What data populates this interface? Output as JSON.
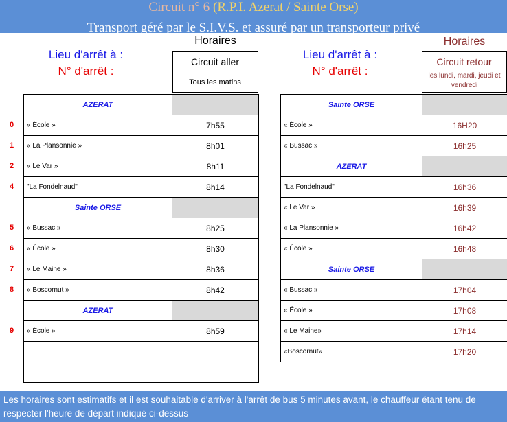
{
  "header": {
    "title_prefix": "Circuit n° 6",
    "title_route": "(R.P.I. Azerat / Sainte Orse)",
    "subtitle": "Transport géré par le S.I.V.S. et assuré par un transporteur privé"
  },
  "labels": {
    "lieu": "Lieu d'arrêt à :",
    "numero": "N° d'arrêt :"
  },
  "aller": {
    "horaires": "Horaires",
    "circuit": "Circuit aller",
    "frequency": "Tous les matins",
    "rows": [
      {
        "type": "section",
        "name": "AZERAT",
        "time": ""
      },
      {
        "type": "stop",
        "num": "0",
        "name": "« École »",
        "time": "7h55"
      },
      {
        "type": "stop",
        "num": "1",
        "name": "« La Plansonnie »",
        "time": "8h01"
      },
      {
        "type": "stop",
        "num": "2",
        "name": "« Le Var »",
        "time": "8h11"
      },
      {
        "type": "stop",
        "num": "4",
        "name": "\"La Fondelnaud\"",
        "time": "8h14"
      },
      {
        "type": "section",
        "name": "Sainte ORSE",
        "time": ""
      },
      {
        "type": "stop",
        "num": "5",
        "name": " « Bussac »",
        "time": "8h25"
      },
      {
        "type": "stop",
        "num": "6",
        "name": "« École »",
        "time": "8h30"
      },
      {
        "type": "stop",
        "num": "7",
        "name": "« Le Maine »",
        "time": "8h36"
      },
      {
        "type": "stop",
        "num": "8",
        "name": "« Boscornut »",
        "time": "8h42"
      },
      {
        "type": "section",
        "name": "AZERAT",
        "time": ""
      },
      {
        "type": "stop",
        "num": "9",
        "name": "« École »",
        "time": "8h59"
      },
      {
        "type": "empty",
        "num": "",
        "name": "",
        "time": ""
      },
      {
        "type": "empty",
        "num": "",
        "name": "",
        "time": ""
      }
    ]
  },
  "retour": {
    "horaires": "Horaires",
    "circuit": "Circuit retour",
    "frequency": "les lundi, mardi, jeudi et vendredi",
    "rows": [
      {
        "type": "section",
        "name": "Sainte ORSE",
        "time": ""
      },
      {
        "type": "stop",
        "name": "« École »",
        "time": "16H20"
      },
      {
        "type": "stop",
        "name": "« Bussac »",
        "time": "16h25"
      },
      {
        "type": "section",
        "name": "AZERAT",
        "time": ""
      },
      {
        "type": "stop",
        "name": "\"La Fondelnaud\"",
        "time": "16h36"
      },
      {
        "type": "stop",
        "name": "« Le Var »",
        "time": "16h39"
      },
      {
        "type": "stop",
        "name": " « La Plansonnie »",
        "time": "16h42"
      },
      {
        "type": "stop",
        "name": "« École »",
        "time": "16h48"
      },
      {
        "type": "section",
        "name": "Sainte ORSE",
        "time": ""
      },
      {
        "type": "stop",
        "name": "« Bussac »",
        "time": "17h04"
      },
      {
        "type": "stop",
        "name": "« École »",
        "time": "17h08"
      },
      {
        "type": "stop",
        "name": "« Le Maine»",
        "time": "17h14"
      },
      {
        "type": "stop",
        "name": "«Boscornut»",
        "time": "17h20"
      }
    ]
  },
  "footer": {
    "note": "Les horaires sont estimatifs et il est souhaitable d'arriver à l'arrêt de bus 5 minutes avant, le chauffeur étant tenu de respecter l'heure de départ indiqué ci-dessus"
  }
}
